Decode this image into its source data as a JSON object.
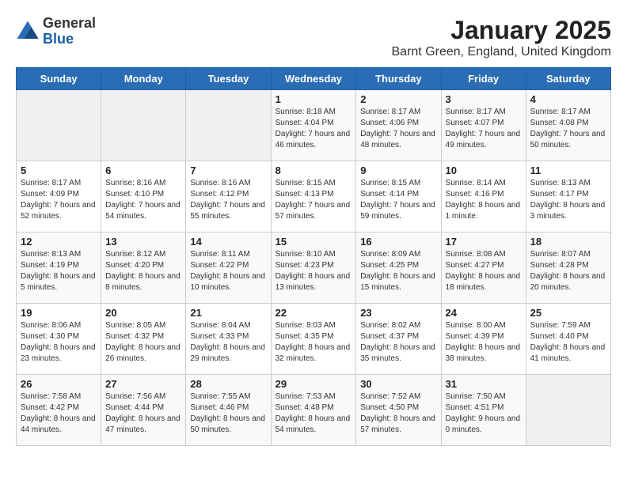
{
  "logo": {
    "general": "General",
    "blue": "Blue"
  },
  "header": {
    "title": "January 2025",
    "subtitle": "Barnt Green, England, United Kingdom"
  },
  "weekdays": [
    "Sunday",
    "Monday",
    "Tuesday",
    "Wednesday",
    "Thursday",
    "Friday",
    "Saturday"
  ],
  "weeks": [
    [
      {
        "day": "",
        "info": ""
      },
      {
        "day": "",
        "info": ""
      },
      {
        "day": "",
        "info": ""
      },
      {
        "day": "1",
        "info": "Sunrise: 8:18 AM\nSunset: 4:04 PM\nDaylight: 7 hours and 46 minutes."
      },
      {
        "day": "2",
        "info": "Sunrise: 8:17 AM\nSunset: 4:06 PM\nDaylight: 7 hours and 48 minutes."
      },
      {
        "day": "3",
        "info": "Sunrise: 8:17 AM\nSunset: 4:07 PM\nDaylight: 7 hours and 49 minutes."
      },
      {
        "day": "4",
        "info": "Sunrise: 8:17 AM\nSunset: 4:08 PM\nDaylight: 7 hours and 50 minutes."
      }
    ],
    [
      {
        "day": "5",
        "info": "Sunrise: 8:17 AM\nSunset: 4:09 PM\nDaylight: 7 hours and 52 minutes."
      },
      {
        "day": "6",
        "info": "Sunrise: 8:16 AM\nSunset: 4:10 PM\nDaylight: 7 hours and 54 minutes."
      },
      {
        "day": "7",
        "info": "Sunrise: 8:16 AM\nSunset: 4:12 PM\nDaylight: 7 hours and 55 minutes."
      },
      {
        "day": "8",
        "info": "Sunrise: 8:15 AM\nSunset: 4:13 PM\nDaylight: 7 hours and 57 minutes."
      },
      {
        "day": "9",
        "info": "Sunrise: 8:15 AM\nSunset: 4:14 PM\nDaylight: 7 hours and 59 minutes."
      },
      {
        "day": "10",
        "info": "Sunrise: 8:14 AM\nSunset: 4:16 PM\nDaylight: 8 hours and 1 minute."
      },
      {
        "day": "11",
        "info": "Sunrise: 8:13 AM\nSunset: 4:17 PM\nDaylight: 8 hours and 3 minutes."
      }
    ],
    [
      {
        "day": "12",
        "info": "Sunrise: 8:13 AM\nSunset: 4:19 PM\nDaylight: 8 hours and 5 minutes."
      },
      {
        "day": "13",
        "info": "Sunrise: 8:12 AM\nSunset: 4:20 PM\nDaylight: 8 hours and 8 minutes."
      },
      {
        "day": "14",
        "info": "Sunrise: 8:11 AM\nSunset: 4:22 PM\nDaylight: 8 hours and 10 minutes."
      },
      {
        "day": "15",
        "info": "Sunrise: 8:10 AM\nSunset: 4:23 PM\nDaylight: 8 hours and 13 minutes."
      },
      {
        "day": "16",
        "info": "Sunrise: 8:09 AM\nSunset: 4:25 PM\nDaylight: 8 hours and 15 minutes."
      },
      {
        "day": "17",
        "info": "Sunrise: 8:08 AM\nSunset: 4:27 PM\nDaylight: 8 hours and 18 minutes."
      },
      {
        "day": "18",
        "info": "Sunrise: 8:07 AM\nSunset: 4:28 PM\nDaylight: 8 hours and 20 minutes."
      }
    ],
    [
      {
        "day": "19",
        "info": "Sunrise: 8:06 AM\nSunset: 4:30 PM\nDaylight: 8 hours and 23 minutes."
      },
      {
        "day": "20",
        "info": "Sunrise: 8:05 AM\nSunset: 4:32 PM\nDaylight: 8 hours and 26 minutes."
      },
      {
        "day": "21",
        "info": "Sunrise: 8:04 AM\nSunset: 4:33 PM\nDaylight: 8 hours and 29 minutes."
      },
      {
        "day": "22",
        "info": "Sunrise: 8:03 AM\nSunset: 4:35 PM\nDaylight: 8 hours and 32 minutes."
      },
      {
        "day": "23",
        "info": "Sunrise: 8:02 AM\nSunset: 4:37 PM\nDaylight: 8 hours and 35 minutes."
      },
      {
        "day": "24",
        "info": "Sunrise: 8:00 AM\nSunset: 4:39 PM\nDaylight: 8 hours and 38 minutes."
      },
      {
        "day": "25",
        "info": "Sunrise: 7:59 AM\nSunset: 4:40 PM\nDaylight: 8 hours and 41 minutes."
      }
    ],
    [
      {
        "day": "26",
        "info": "Sunrise: 7:58 AM\nSunset: 4:42 PM\nDaylight: 8 hours and 44 minutes."
      },
      {
        "day": "27",
        "info": "Sunrise: 7:56 AM\nSunset: 4:44 PM\nDaylight: 8 hours and 47 minutes."
      },
      {
        "day": "28",
        "info": "Sunrise: 7:55 AM\nSunset: 4:46 PM\nDaylight: 8 hours and 50 minutes."
      },
      {
        "day": "29",
        "info": "Sunrise: 7:53 AM\nSunset: 4:48 PM\nDaylight: 8 hours and 54 minutes."
      },
      {
        "day": "30",
        "info": "Sunrise: 7:52 AM\nSunset: 4:50 PM\nDaylight: 8 hours and 57 minutes."
      },
      {
        "day": "31",
        "info": "Sunrise: 7:50 AM\nSunset: 4:51 PM\nDaylight: 9 hours and 0 minutes."
      },
      {
        "day": "",
        "info": ""
      }
    ]
  ]
}
